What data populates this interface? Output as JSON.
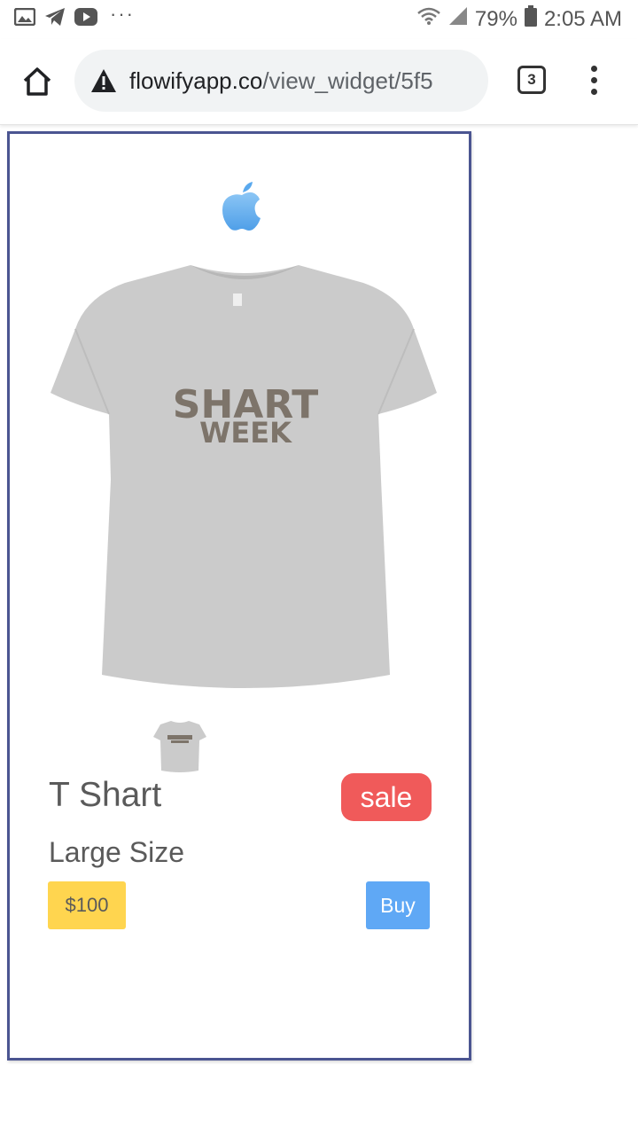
{
  "status_bar": {
    "overflow": "···",
    "battery": "79%",
    "time": "2:05 AM",
    "icons": [
      "gallery-icon",
      "telegram-icon",
      "youtube-icon",
      "wifi-icon",
      "signal-icon",
      "battery-icon"
    ]
  },
  "browser": {
    "url_domain": "flowifyapp.co",
    "url_path": "/view_widget/5f5",
    "tab_count": "3"
  },
  "widget": {
    "title": "T Shart",
    "badge": "sale",
    "subtitle": "Large Size",
    "price": "$100",
    "buy_label": "Buy",
    "shirt_print": {
      "line1": "SHART",
      "line2": "WEEK"
    },
    "colors": {
      "border": "#4b5591",
      "sale": "#f05a5a",
      "price": "#ffd54f",
      "buy": "#5fa8f5",
      "brand": "#5aa9ee",
      "shirt": "#c9c9c9",
      "print": "#7d746a"
    }
  }
}
